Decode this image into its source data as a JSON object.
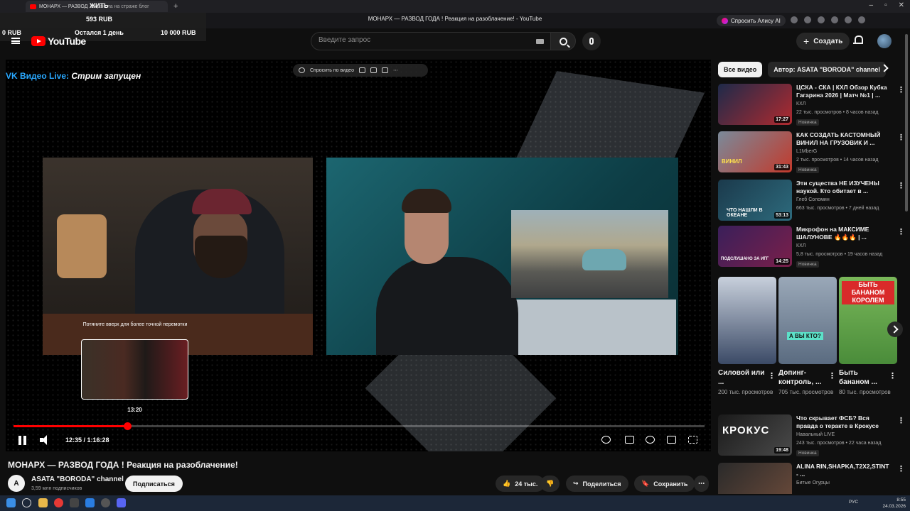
{
  "browser": {
    "tab_title": "МОНАРХ — РАЗВОД",
    "tab_subtitle": "Охранота на страже блог",
    "page_title": "МОНАРХ — РАЗВОД ГОДА ! Реакция на разоблачение! - YouTube",
    "alisa_label": "Спросить Алису AI"
  },
  "overlay": {
    "live_tag": "ЖИТЬ",
    "balance": "593 RUB",
    "current": "0 RUB",
    "remaining": "Остался 1 день",
    "goal": "10 000 RUB"
  },
  "header": {
    "logo_text": "YouTube",
    "search_placeholder": "Введите запрос",
    "create_label": "Создать"
  },
  "player": {
    "vk_label": "VK Видео Live:",
    "vk_status": "Стрим запущен",
    "ask_label": "Спросить по видео",
    "seek_hint": "Потяните вверх для более точной перемотки",
    "seek_time": "13:20",
    "time_display": "12:35 / 1:16:28",
    "progress_fraction": 0.1645
  },
  "video": {
    "title": "МОНАРХ — РАЗВОД ГОДА ! Реакция на разоблачение!",
    "channel_initial": "A",
    "channel_name": "ASATA \"BORODA\" channel",
    "subscribers": "3,59 млн подписчиков",
    "subscribe_label": "Подписаться",
    "likes": "24 тыс.",
    "share_label": "Поделиться",
    "save_label": "Сохранить"
  },
  "sidebar": {
    "chips": [
      "Все видео",
      "Автор: ASATA \"BORODA\" channel"
    ],
    "recommendations": [
      {
        "title": "ЦСКА - СКА | КХЛ Обзор Кубка Гагарина 2026 | Матч №1 | ...",
        "channel": "КХЛ",
        "meta": "22 тыс. просмотров • 8 часов назад",
        "badge": "Новинка",
        "duration": "17:27",
        "color": "#b02a2f"
      },
      {
        "title": "КАК СОЗДАТЬ КАСТОМНЫЙ ВИНИЛ НА ГРУЗОВИК И ...",
        "channel": "L1MberG",
        "meta": "2 тыс. просмотров • 14 часов назад",
        "badge": "Новинка",
        "duration": "31:43",
        "color": "#c23a2c"
      },
      {
        "title": "Эти существа НЕ ИЗУЧЕНЫ наукой. Кто обитает в ...",
        "channel": "Глеб Соломин",
        "meta": "663 тыс. просмотров • 7 дней назад",
        "badge": "",
        "duration": "53:13",
        "color": "#2d6a7c"
      },
      {
        "title": "Микрофон на МАКСИМЕ ШАЛУНОВЕ 🔥🔥🔥 | ...",
        "channel": "КХЛ",
        "meta": "5,8 тыс. просмотров • 19 часов назад",
        "badge": "Новинка",
        "duration": "14:25",
        "color": "#7a1f4a"
      },
      {
        "title": "Что скрывает ФСБ? Вся правда о теракте в Крокусе",
        "channel": "Навальный LIVE",
        "meta": "243 тыс. просмотров • 22 часа назад",
        "badge": "Новинка",
        "duration": "19:48",
        "color": "#2b2b2b"
      },
      {
        "title": "ALINA RIN,SHAPKA,T2X2,STINT - ...",
        "channel": "Битые Огурцы",
        "meta": "",
        "badge": "",
        "duration": "",
        "color": "#6a4a3a"
      }
    ],
    "shorts": [
      {
        "title": "Силовой или ...",
        "views": "200 тыс. просмотров",
        "color": "#3b4a66"
      },
      {
        "title": "Допинг-контроль, ...",
        "views": "705 тыс. просмотров",
        "color": "#5a6b80"
      },
      {
        "title": "Быть бананом ...",
        "views": "80 тыс. просмотров",
        "color": "#4a8c3a"
      }
    ],
    "thumb_texts": [
      "КРОКУС",
      "ВИНИЛ",
      "ЧТО НАШЛИ В ОКЕАНЕ",
      "ПОДСЛУШАНО ЗА ИГГ",
      "БЫТЬ БАНАНОМ КОРОЛЕМ",
      "А ВЫ КТО?"
    ]
  },
  "taskbar": {
    "lang": "РУС",
    "time": "8:55",
    "date": "24.03.2026"
  }
}
